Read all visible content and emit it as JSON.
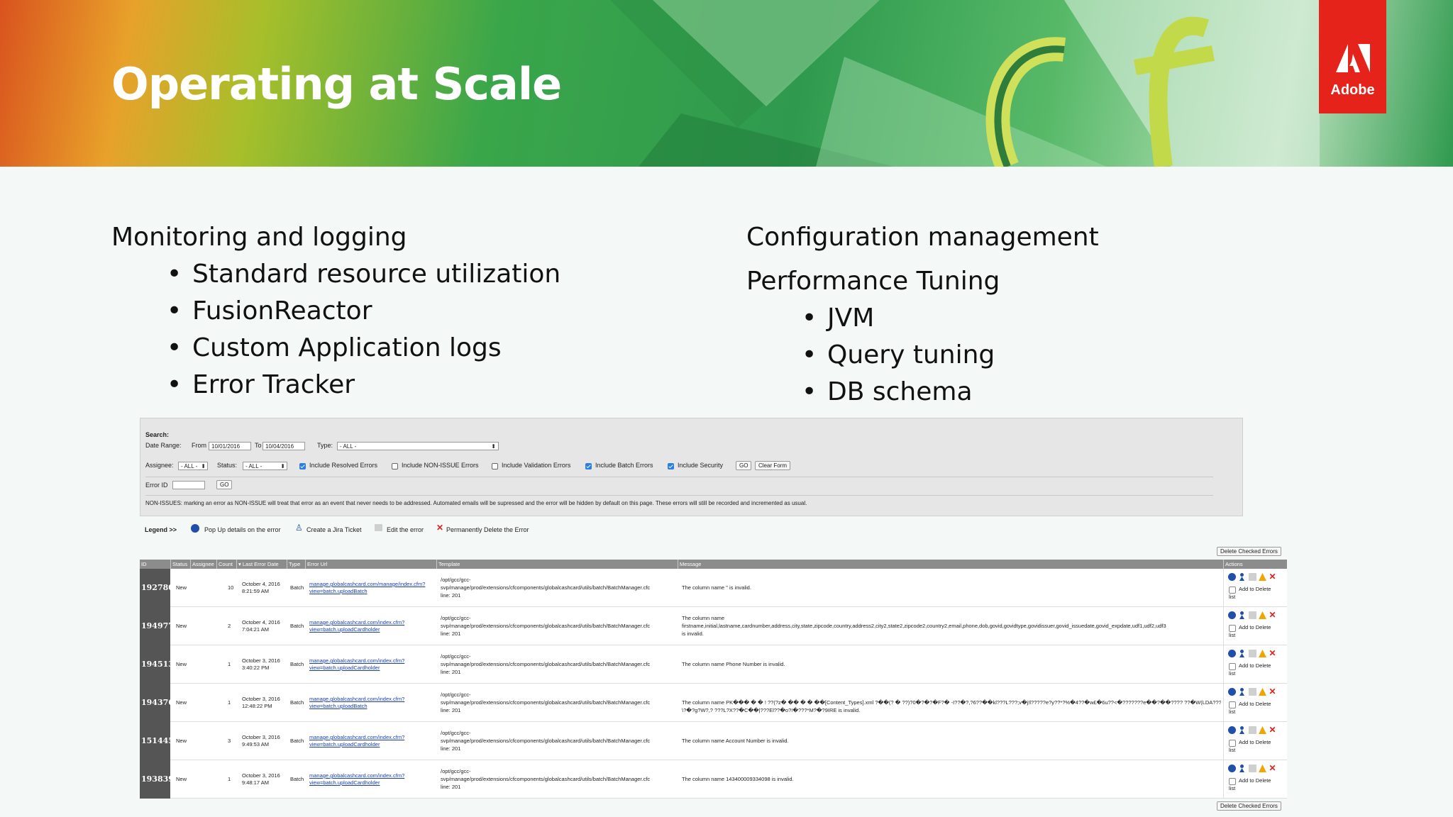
{
  "slide": {
    "title": "Operating at Scale"
  },
  "brand": {
    "name": "Adobe",
    "accent": "#e5231b"
  },
  "left_column": {
    "heading": "Monitoring and logging",
    "bullets": [
      "Standard resource utilization",
      "FusionReactor",
      "Custom Application logs",
      "Error Tracker"
    ]
  },
  "right_column": {
    "heading1": "Configuration management",
    "heading2": "Performance Tuning",
    "bullets": [
      "JVM",
      "Query tuning",
      "DB schema"
    ]
  },
  "search": {
    "title": "Search:",
    "date_range_label": "Date Range:",
    "from_label": "From",
    "from_value": "10/01/2016",
    "to_label": "To",
    "to_value": "10/04/2016",
    "type_label": "Type:",
    "type_value": "- ALL -",
    "assignee_label": "Assignee:",
    "assignee_value": "- ALL -",
    "status_label": "Status:",
    "status_value": "- ALL -",
    "checks": [
      {
        "label": "Include Resolved Errors",
        "checked": true
      },
      {
        "label": "Include NON-ISSUE Errors",
        "checked": false
      },
      {
        "label": "Include Validation Errors",
        "checked": false
      },
      {
        "label": "Include Batch Errors",
        "checked": true
      },
      {
        "label": "Include Security",
        "checked": true
      }
    ],
    "go_label": "GO",
    "clear_label": "Clear Form",
    "error_id_label": "Error ID",
    "error_id_go": "GO",
    "note": "NON-ISSUES: marking an error as NON-ISSUE will treat that error as an event that never needs to be addressed. Automated emails will be supressed and the error will be hidden by default on this page. These errors will still be recorded and incremented as usual."
  },
  "legend": {
    "title": "Legend >>",
    "popup": "Pop Up details on the error",
    "jira": "Create a Jira Ticket",
    "edit": "Edit the error",
    "delete": "Permanently Delete the Error"
  },
  "delete_checked_label": "Delete Checked Errors",
  "table": {
    "headers": [
      "ID",
      "Status",
      "Assignee",
      "Count",
      "Last Error Date",
      "Type",
      "Error Url",
      "Template",
      "Message",
      "Actions"
    ],
    "add_to_delete": "Add to Delete list",
    "rows": [
      {
        "id": "192780",
        "status": "New",
        "count": "10",
        "date1": "October 4, 2016",
        "date2": "8:21:59 AM",
        "type": "Batch",
        "url1": "manage.globalcashcard.com/manage/index.cfm?",
        "url2": "view=batch.uploadBatch",
        "tpl1": "/opt/gcc/gcc-",
        "tpl2": "svp/manage/prod/extensions/cfcomponents/globalcashcard/utils/batch/BatchManager.cfc",
        "tpl3": "line: 201",
        "msg1": "",
        "msg2": "The column name '' is invalid.",
        "msg3": ""
      },
      {
        "id": "194977",
        "status": "New",
        "count": "2",
        "date1": "October 4, 2016",
        "date2": "7:04:21 AM",
        "type": "Batch",
        "url1": "manage.globalcashcard.com/index.cfm?",
        "url2": "view=batch.uploadCardholder",
        "tpl1": "/opt/gcc/gcc-",
        "tpl2": "svp/manage/prod/extensions/cfcomponents/globalcashcard/utils/batch/BatchManager.cfc",
        "tpl3": "line: 201",
        "msg1": "The column name",
        "msg2": "firstname,initial,lastname,cardnumber,address,city,state,zipcode,country,address2,city2,state2,zipcode2,country2,email,phone,dob,govid,govidtype,govidissuer,govid_issuedate,govid_expdate,udf1,udf2,udf3",
        "msg3": "is invalid."
      },
      {
        "id": "194513",
        "status": "New",
        "count": "1",
        "date1": "October 3, 2016",
        "date2": "3:40:22 PM",
        "type": "Batch",
        "url1": "manage.globalcashcard.com/index.cfm?",
        "url2": "view=batch.uploadCardholder",
        "tpl1": "/opt/gcc/gcc-",
        "tpl2": "svp/manage/prod/extensions/cfcomponents/globalcashcard/utils/batch/BatchManager.cfc",
        "tpl3": "line: 201",
        "msg1": "",
        "msg2": "The column name Phone Number is invalid.",
        "msg3": ""
      },
      {
        "id": "194376",
        "status": "New",
        "count": "1",
        "date1": "October 3, 2016",
        "date2": "12:48:22 PM",
        "type": "Batch",
        "url1": "manage.globalcashcard.com/index.cfm?",
        "url2": "view=batch.uploadBatch",
        "tpl1": "/opt/gcc/gcc-",
        "tpl2": "svp/manage/prod/extensions/cfcomponents/globalcashcard/utils/batch/BatchManager.cfc",
        "tpl3": "line: 201",
        "msg1": "",
        "msg2": "The column name PK��� � � ! ??(?z� �� � � ��[Content_Types].xml ?��(? � ??)?0�?�?�F?� -I??�?,?6??��kl???L???;v�j!l?????e?y??*?%�4??�w£�6u??<�???????e��?��????  ??�W(LDA???|a?<X>?",
        "msg3": "\\?�?g?W?,? ???L?X??�C��|???El??�o?!�???*M?�?9IRE is invalid."
      },
      {
        "id": "151445",
        "status": "New",
        "count": "3",
        "date1": "October 3, 2016",
        "date2": "9:49:53 AM",
        "type": "Batch",
        "url1": "manage.globalcashcard.com/index.cfm?",
        "url2": "view=batch.uploadCardholder",
        "tpl1": "/opt/gcc/gcc-",
        "tpl2": "svp/manage/prod/extensions/cfcomponents/globalcashcard/utils/batch/BatchManager.cfc",
        "tpl3": "line: 201",
        "msg1": "",
        "msg2": "The column name Account Number is invalid.",
        "msg3": ""
      },
      {
        "id": "193839",
        "status": "New",
        "count": "1",
        "date1": "October 3, 2016",
        "date2": "9:48:17 AM",
        "type": "Batch",
        "url1": "manage.globalcashcard.com/index.cfm?",
        "url2": "view=batch.uploadCardholder",
        "tpl1": "/opt/gcc/gcc-",
        "tpl2": "svp/manage/prod/extensions/cfcomponents/globalcashcard/utils/batch/BatchManager.cfc",
        "tpl3": "line: 201",
        "msg1": "",
        "msg2": "The column name 143400009334098 is invalid.",
        "msg3": ""
      }
    ]
  }
}
